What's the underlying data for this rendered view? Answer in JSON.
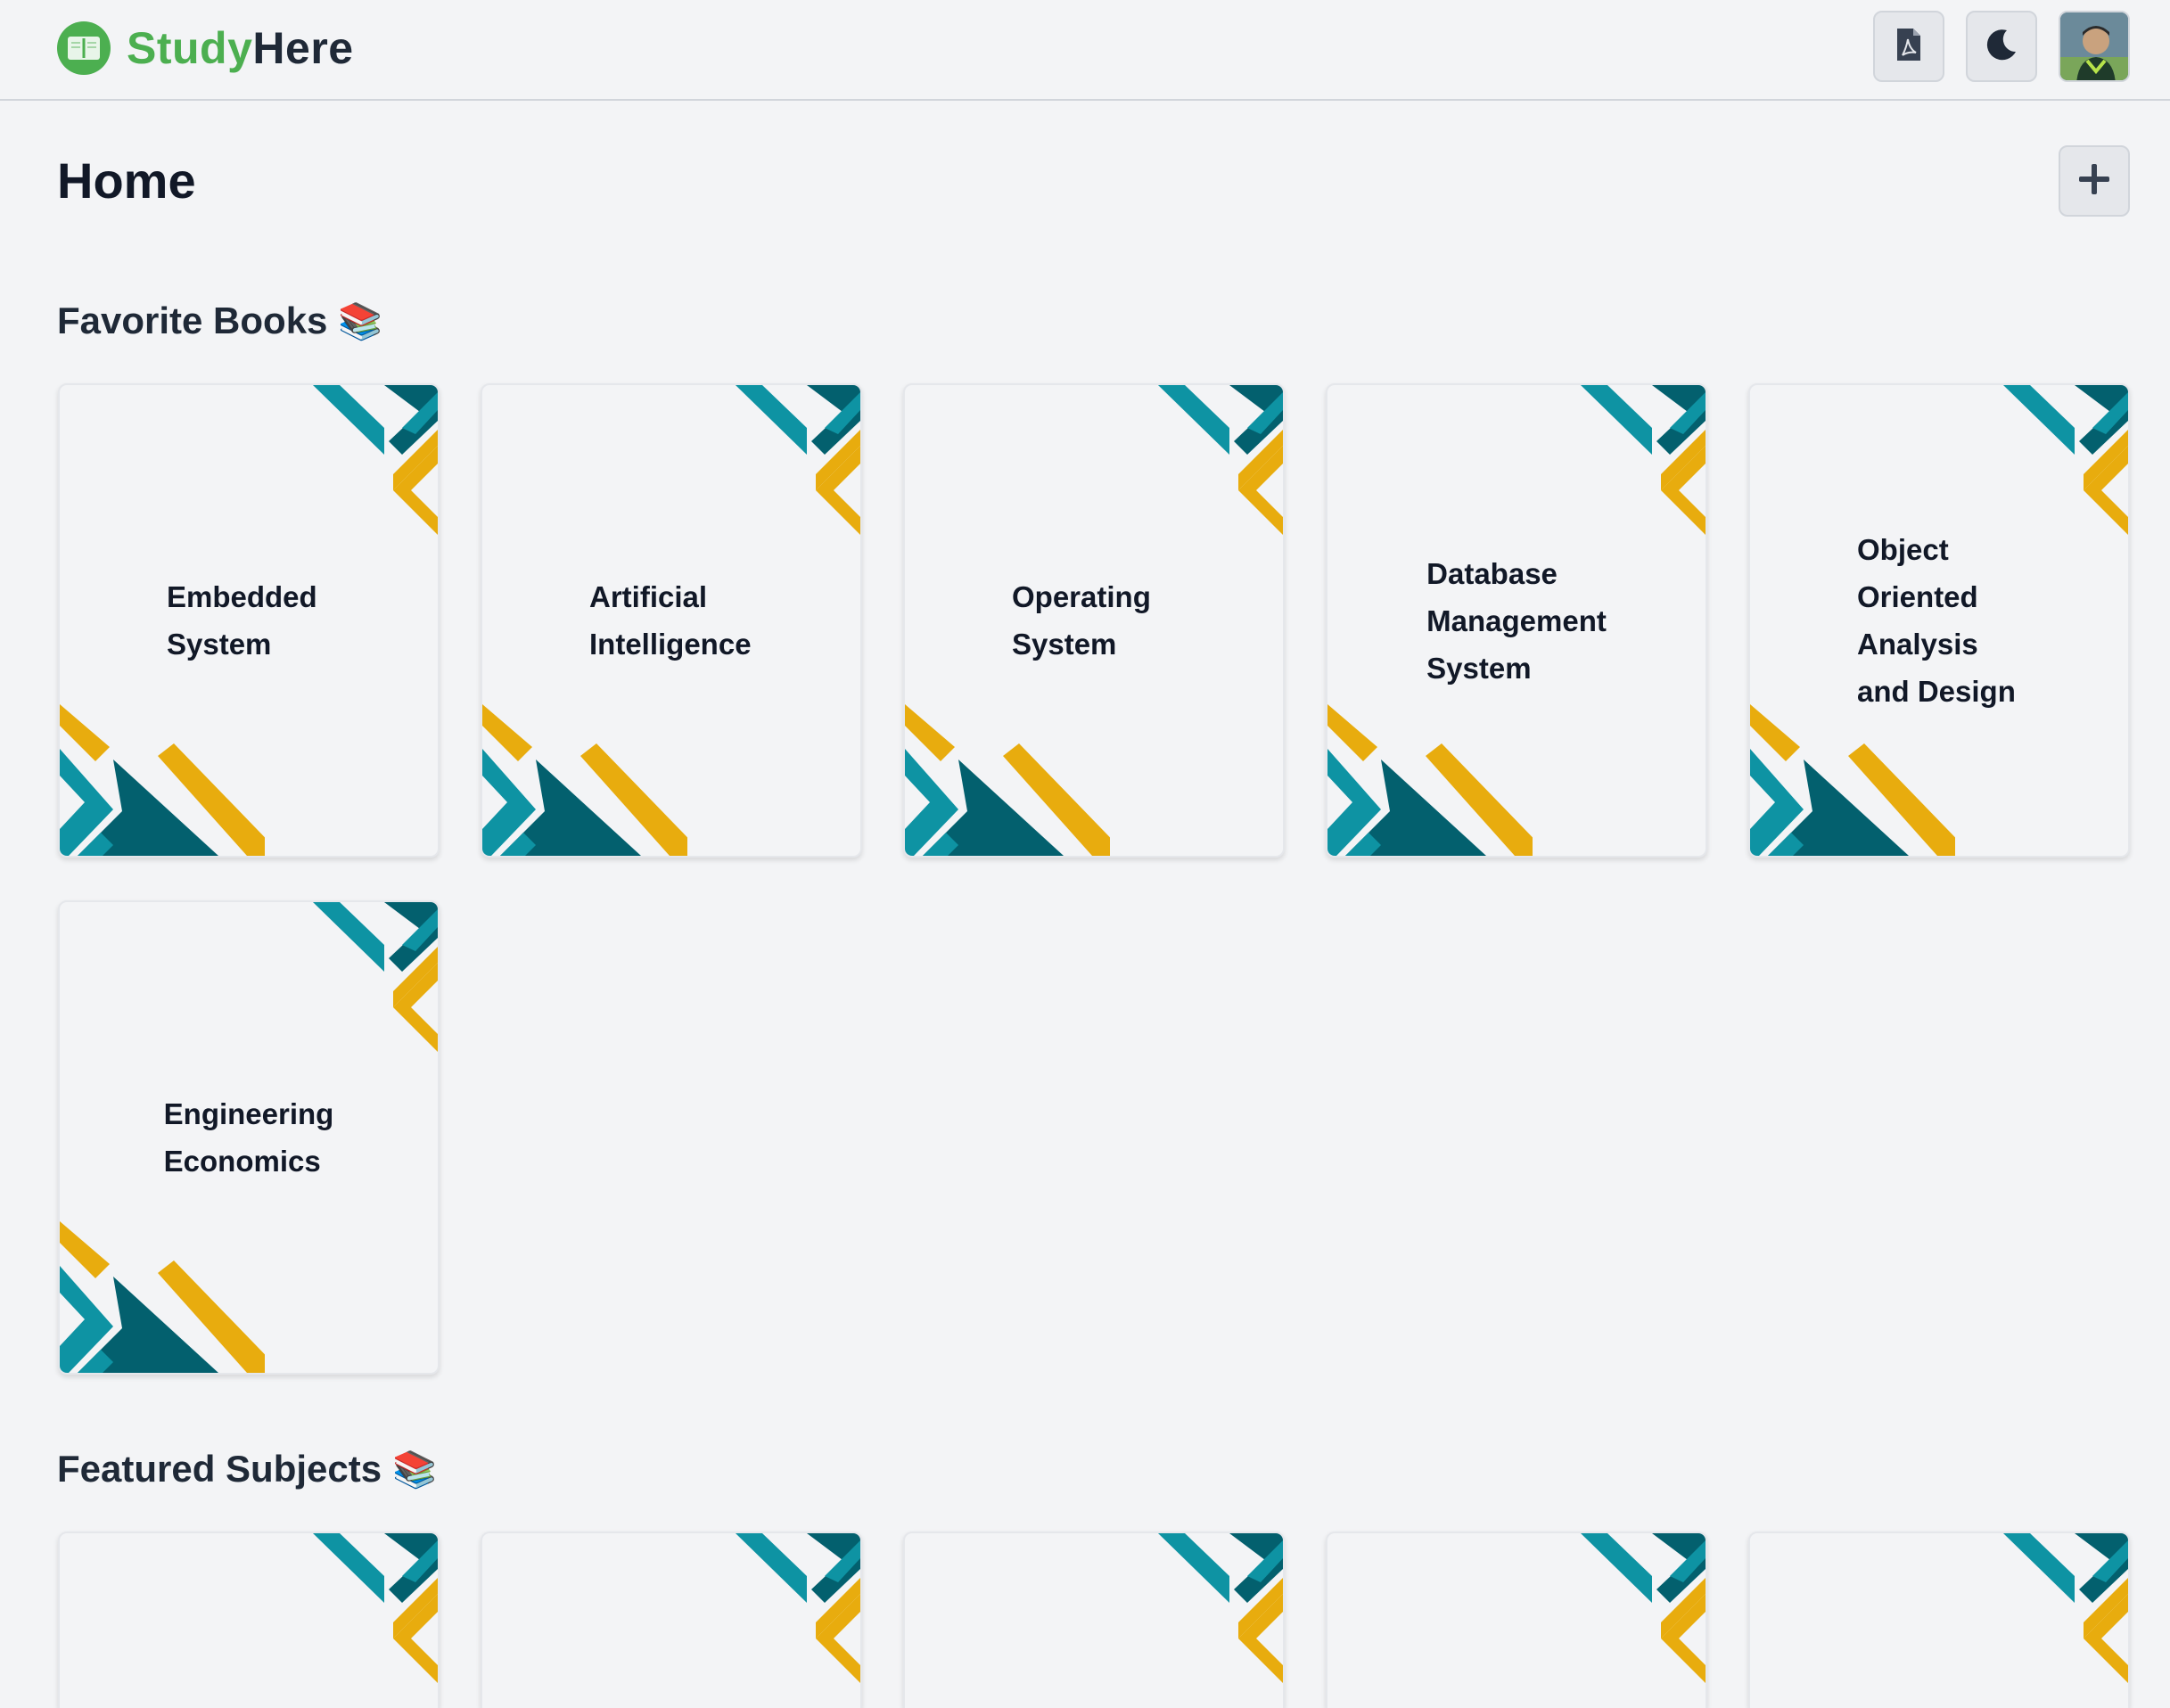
{
  "brand": {
    "part1": "Study",
    "part2": "Here"
  },
  "header": {
    "pdf_icon": "pdf-file-icon",
    "theme_icon": "moon-icon",
    "avatar_alt": "user-avatar"
  },
  "page": {
    "title": "Home",
    "add_icon": "plus-icon"
  },
  "favorites": {
    "title": "Favorite Books",
    "emoji": "📚",
    "books": [
      {
        "title": "Embedded System"
      },
      {
        "title": "Artificial Intelligence"
      },
      {
        "title": "Operating System"
      },
      {
        "title": "Database Management System"
      },
      {
        "title": "Object Oriented Analysis and Design"
      },
      {
        "title": "Engineering Economics"
      }
    ]
  },
  "featured": {
    "title": "Featured Subjects",
    "emoji": "📚",
    "count_visible": 5
  },
  "colors": {
    "brand_green": "#4caf50",
    "teal": "#0e93a3",
    "dark_teal": "#03606e",
    "gold": "#e8ac0e"
  }
}
